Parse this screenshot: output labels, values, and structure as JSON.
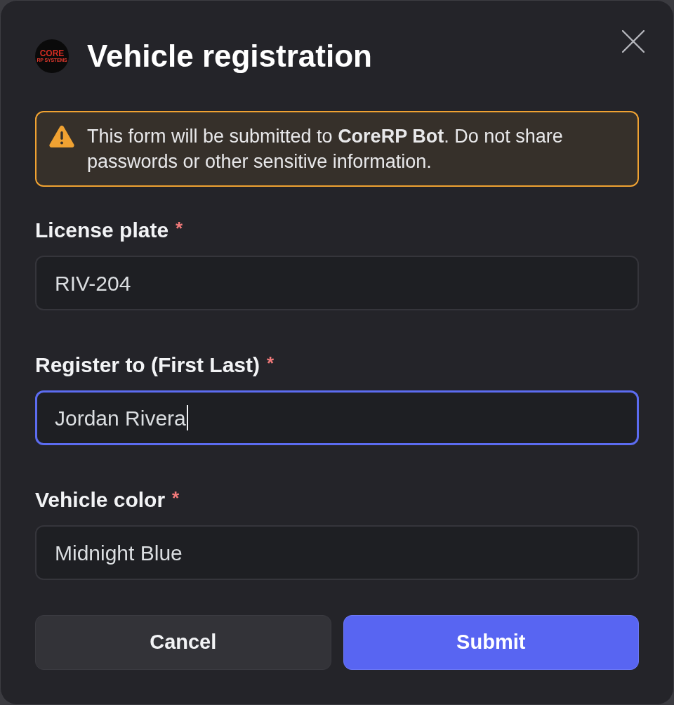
{
  "dialog": {
    "logo": {
      "title": "CORE",
      "subtitle": "RP SYSTEMS"
    },
    "title": "Vehicle registration"
  },
  "notice": {
    "kind": "warning",
    "text": "This form will be submitted to **CoreRP Bot**. Do not share passwords or other sensitive information."
  },
  "fields": [
    {
      "label": "License plate",
      "required_mark": "*",
      "value": "RIV-204",
      "focused": false
    },
    {
      "label": "Register to (First Last)",
      "required_mark": "*",
      "value": "Jordan Rivera",
      "focused": true
    },
    {
      "label": "Vehicle color",
      "required_mark": "*",
      "value": "Midnight Blue",
      "focused": false
    }
  ],
  "buttons": [
    {
      "label": "Cancel",
      "kind": "secondary"
    },
    {
      "label": "Submit",
      "kind": "primary"
    }
  ]
}
